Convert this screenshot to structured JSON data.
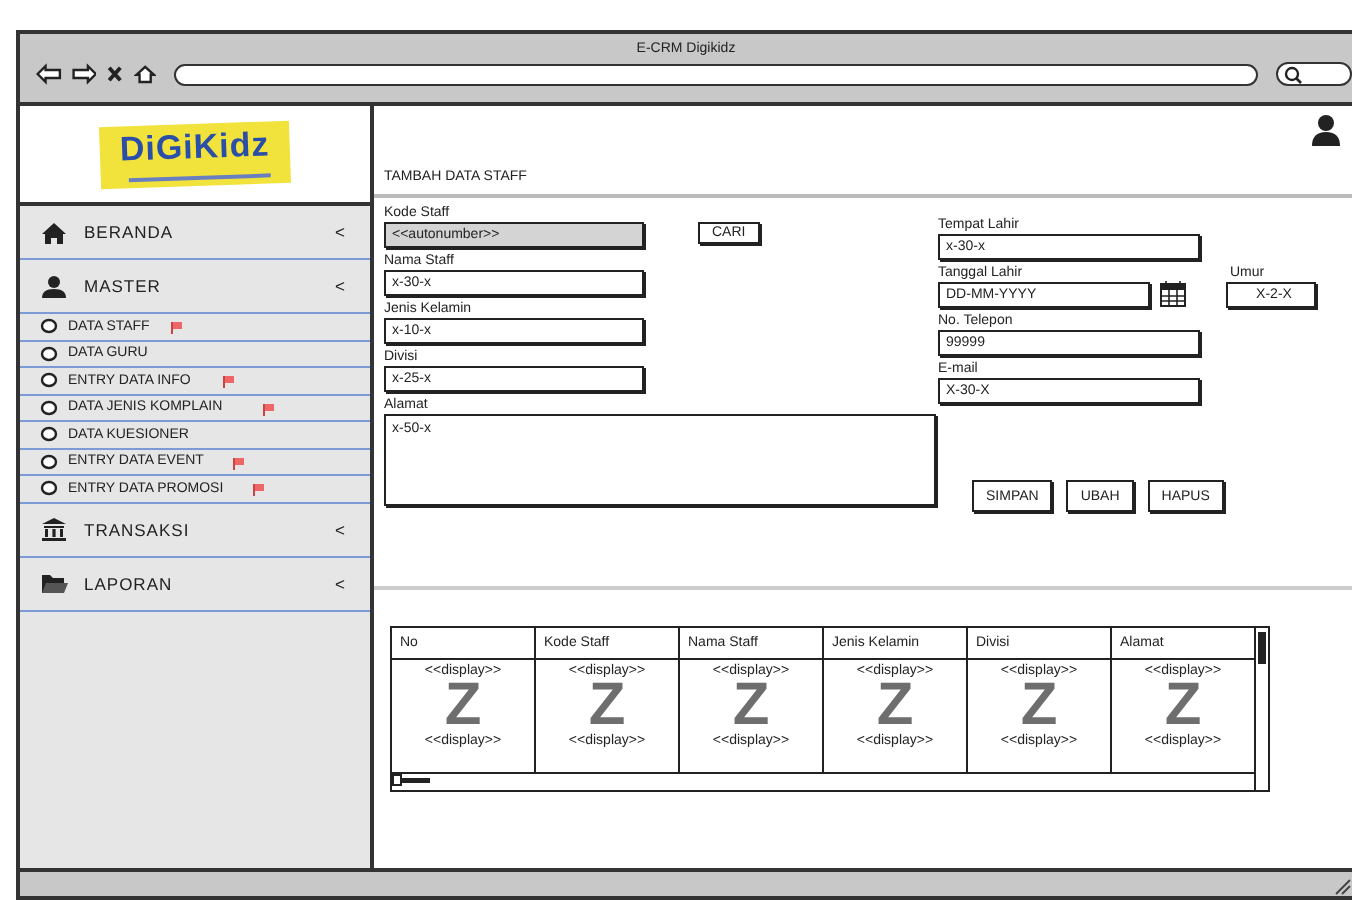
{
  "browser": {
    "title": "E-CRM Digikidz"
  },
  "logo": {
    "text": "DiGiKidz"
  },
  "sidebar": {
    "items": [
      {
        "kind": "menu",
        "label": "BERANDA",
        "arrow": "<"
      },
      {
        "kind": "menu",
        "label": "MASTER",
        "arrow": "<"
      },
      {
        "kind": "sub",
        "label": "DATA STAFF",
        "flagged": true
      },
      {
        "kind": "sub",
        "label": "DATA GURU",
        "flagged": false
      },
      {
        "kind": "sub",
        "label": "ENTRY DATA INFO",
        "flagged": true
      },
      {
        "kind": "sub",
        "label": "DATA JENIS KOMPLAIN",
        "flagged": true
      },
      {
        "kind": "sub",
        "label": "DATA KUESIONER",
        "flagged": false
      },
      {
        "kind": "sub",
        "label": "ENTRY DATA EVENT",
        "flagged": true
      },
      {
        "kind": "sub",
        "label": "ENTRY DATA PROMOSI",
        "flagged": true
      },
      {
        "kind": "menu",
        "label": "TRANSAKSI",
        "arrow": "<"
      },
      {
        "kind": "menu",
        "label": "LAPORAN",
        "arrow": "<"
      }
    ]
  },
  "page": {
    "heading": "TAMBAH DATA STAFF"
  },
  "form": {
    "search_button": "CARI",
    "left_fields": [
      {
        "kind": "text",
        "label": "Kode Staff",
        "value": "<<autonumber>>",
        "disabled": true
      },
      {
        "kind": "text",
        "label": "Nama Staff",
        "value": "x-30-x",
        "disabled": false
      },
      {
        "kind": "text",
        "label": "Jenis Kelamin",
        "value": "x-10-x",
        "disabled": false
      },
      {
        "kind": "text",
        "label": "Divisi",
        "value": "x-25-x",
        "disabled": false
      },
      {
        "kind": "textarea",
        "label": "Alamat",
        "value": "x-50-x",
        "disabled": false
      }
    ],
    "right_fields": [
      {
        "kind": "text",
        "label": "Tempat Lahir",
        "value": "x-30-x",
        "disabled": false
      },
      {
        "kind": "date",
        "label": "Tanggal Lahir",
        "value": "DD-MM-YYYY",
        "disabled": false,
        "extra_label": "Umur",
        "extra_value": "X-2-X"
      },
      {
        "kind": "text",
        "label": "No. Telepon",
        "value": "99999",
        "disabled": false
      },
      {
        "kind": "text",
        "label": "E-mail",
        "value": "X-30-X",
        "disabled": false
      }
    ],
    "buttons": [
      "SIMPAN",
      "UBAH",
      "HAPUS"
    ]
  },
  "table": {
    "columns": [
      "No",
      "Kode Staff",
      "Nama Staff",
      "Jenis Kelamin",
      "Divisi",
      "Alamat"
    ],
    "rows": [
      [
        {
          "top": "<<display>>",
          "mark": "Z",
          "bottom": "<<display>>"
        },
        {
          "top": "<<display>>",
          "mark": "Z",
          "bottom": "<<display>>"
        },
        {
          "top": "<<display>>",
          "mark": "Z",
          "bottom": "<<display>>"
        },
        {
          "top": "<<display>>",
          "mark": "Z",
          "bottom": "<<display>>"
        },
        {
          "top": "<<display>>",
          "mark": "Z",
          "bottom": "<<display>>"
        },
        {
          "top": "<<display>>",
          "mark": "Z",
          "bottom": "<<display>>"
        }
      ]
    ]
  }
}
